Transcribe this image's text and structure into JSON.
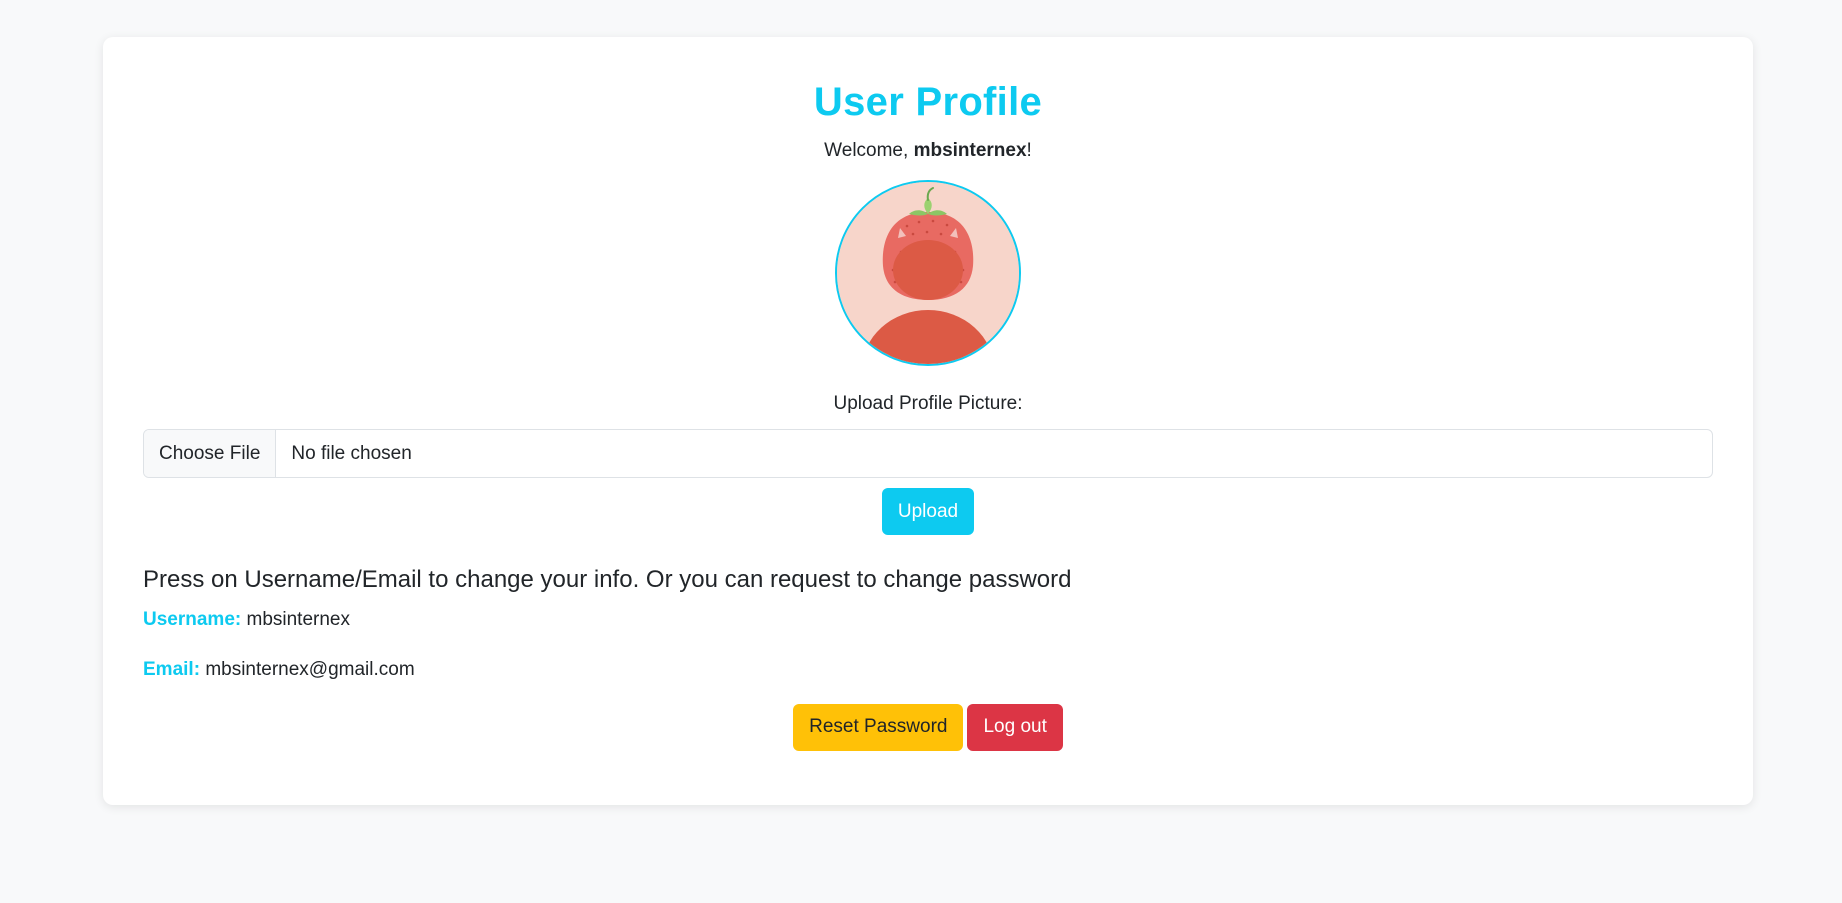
{
  "page": {
    "title": "User Profile",
    "welcome_prefix": "Welcome, ",
    "welcome_username": "mbsinternex",
    "welcome_suffix": "!"
  },
  "avatar": {
    "icon": "strawberry-avatar-icon"
  },
  "upload": {
    "label": "Upload Profile Picture:",
    "choose_file_label": "Choose File",
    "file_status": "No file chosen",
    "button_label": "Upload"
  },
  "info": {
    "heading": "Press on Username/Email to change your info. Or you can request to change password",
    "username_label": "Username:",
    "username_value": "mbsinternex",
    "email_label": "Email:",
    "email_value": "mbsinternex@gmail.com"
  },
  "actions": {
    "reset_label": "Reset Password",
    "logout_label": "Log out"
  },
  "colors": {
    "accent": "#0dcaf0",
    "warning": "#ffc107",
    "danger": "#dc3545",
    "background": "#f8f9fa"
  }
}
